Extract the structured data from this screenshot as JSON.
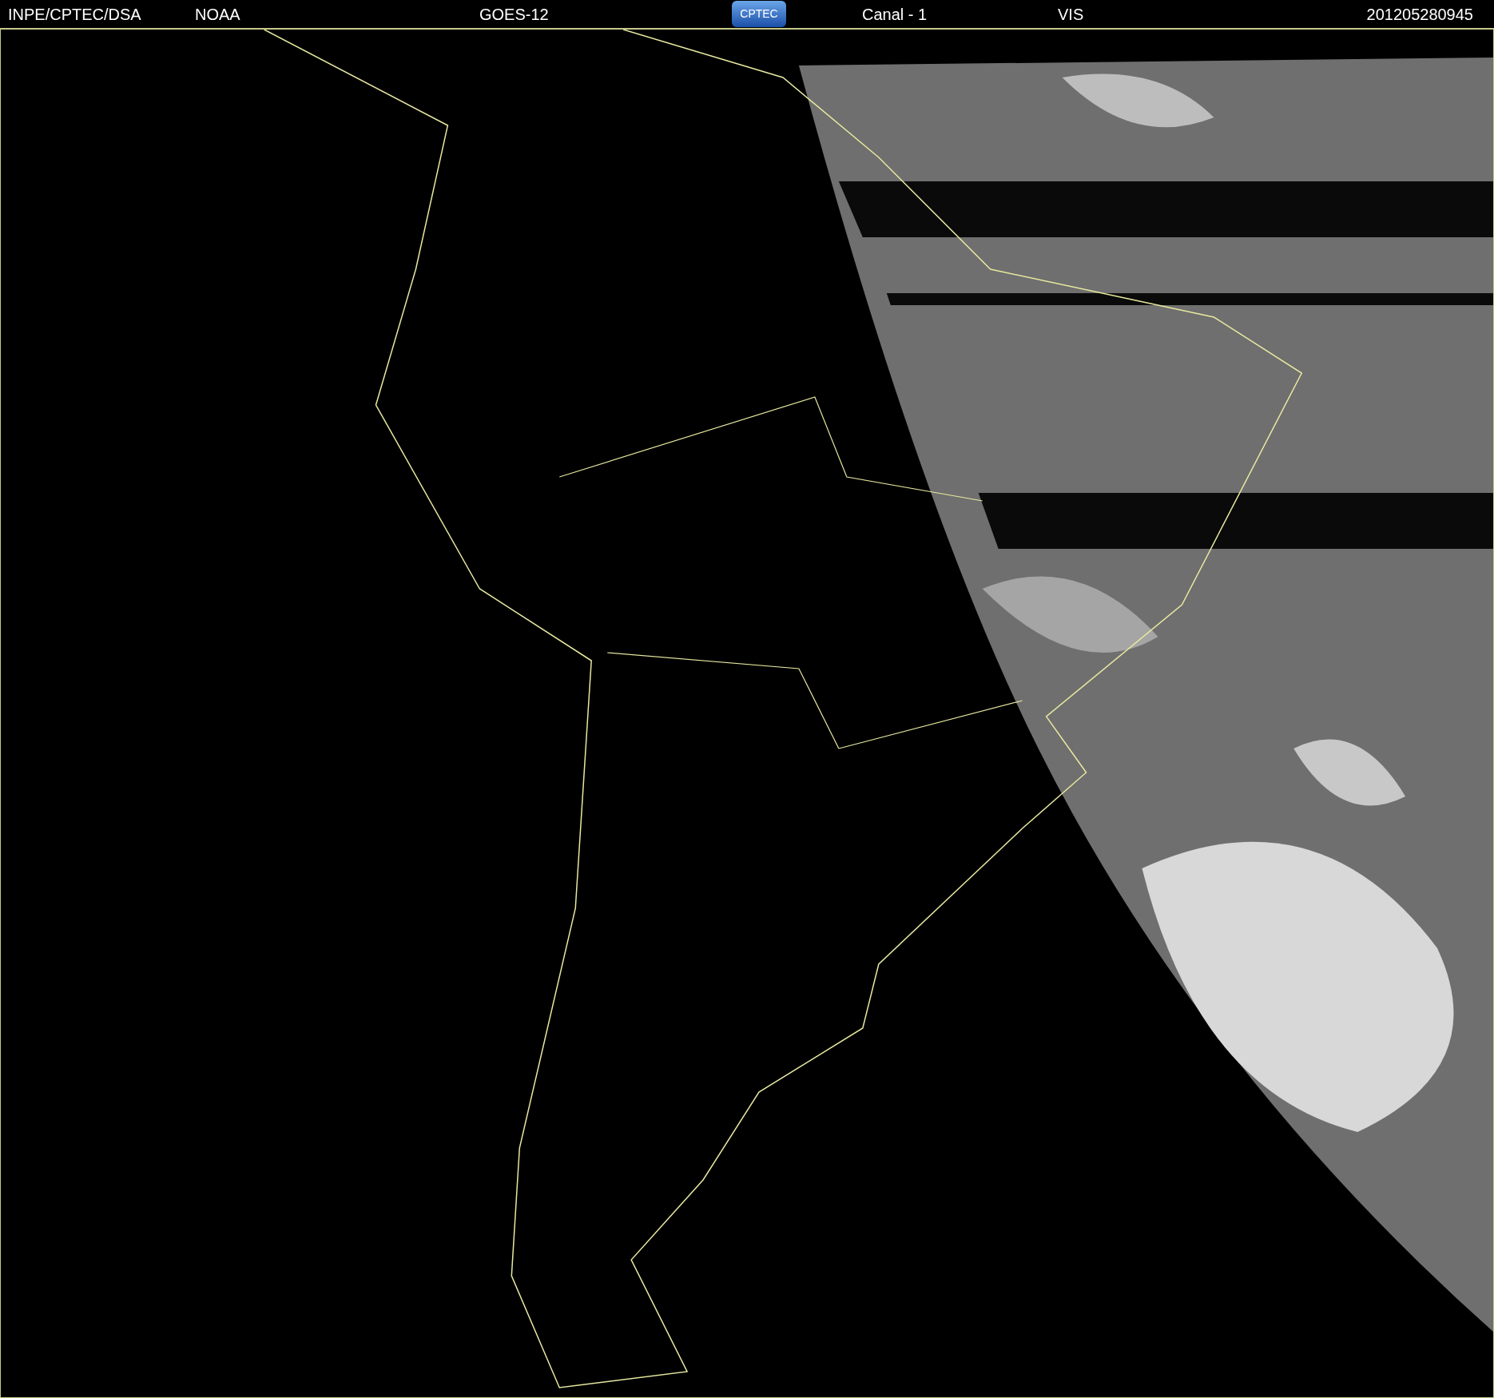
{
  "header": {
    "items": [
      {
        "kind": "text",
        "text": "INPE/CPTEC/DSA"
      },
      {
        "kind": "text",
        "text": "NOAA"
      },
      {
        "kind": "text",
        "text": "GOES-12"
      },
      {
        "kind": "logo",
        "text": "CPTEC"
      },
      {
        "kind": "text",
        "text": "Canal - 1"
      },
      {
        "kind": "text",
        "text": "VIS"
      },
      {
        "kind": "text",
        "text": "201205280945"
      }
    ]
  }
}
